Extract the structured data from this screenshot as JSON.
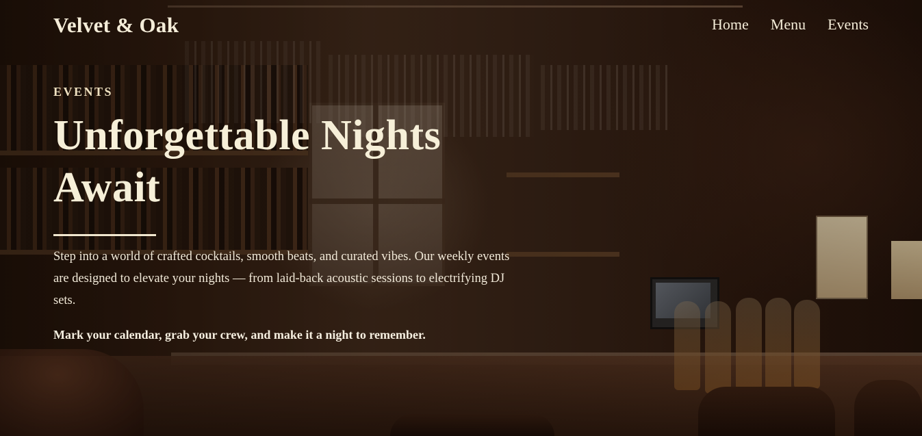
{
  "header": {
    "logo": "Velvet & Oak",
    "nav": [
      {
        "label": "Home"
      },
      {
        "label": "Menu"
      },
      {
        "label": "Events"
      }
    ]
  },
  "hero": {
    "eyebrow": "EVENTS",
    "title_line1": "Unforgettable Nights",
    "title_line2": "Await",
    "description": "Step into a world of crafted cocktails, smooth beats, and curated vibes. Our weekly events are designed to elevate your nights — from laid-back acoustic sessions to electrifying DJ sets.",
    "cta_text": "Mark your calendar, grab your crew, and make it a night to remember."
  },
  "colors": {
    "text_primary": "#f6efd8",
    "background_dark": "#1b0f09"
  }
}
